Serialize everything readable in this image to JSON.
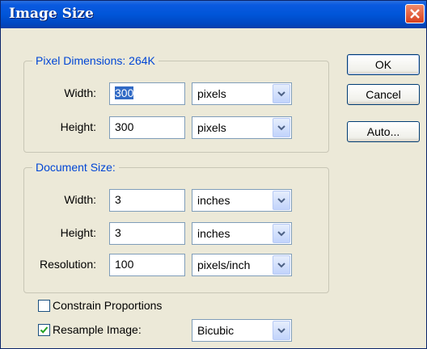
{
  "window": {
    "title": "Image Size"
  },
  "pixel_dimensions": {
    "legend": "Pixel Dimensions:  264K",
    "width_label": "Width:",
    "width_value": "300",
    "width_unit": "pixels",
    "height_label": "Height:",
    "height_value": "300",
    "height_unit": "pixels"
  },
  "document_size": {
    "legend": "Document Size:",
    "width_label": "Width:",
    "width_value": "3",
    "width_unit": "inches",
    "height_label": "Height:",
    "height_value": "3",
    "height_unit": "inches",
    "resolution_label": "Resolution:",
    "resolution_value": "100",
    "resolution_unit": "pixels/inch"
  },
  "options": {
    "constrain_label": "Constrain Proportions",
    "constrain_checked": false,
    "resample_label": "Resample Image:",
    "resample_checked": true,
    "resample_method": "Bicubic"
  },
  "buttons": {
    "ok": "OK",
    "cancel": "Cancel",
    "auto": "Auto..."
  },
  "colors": {
    "titlebar": "#0055d8",
    "legend_text": "#0046d5",
    "background": "#ece9d8"
  },
  "icons": {
    "close": "close-icon",
    "dropdown": "chevron-down-icon",
    "check": "checkmark-icon"
  }
}
